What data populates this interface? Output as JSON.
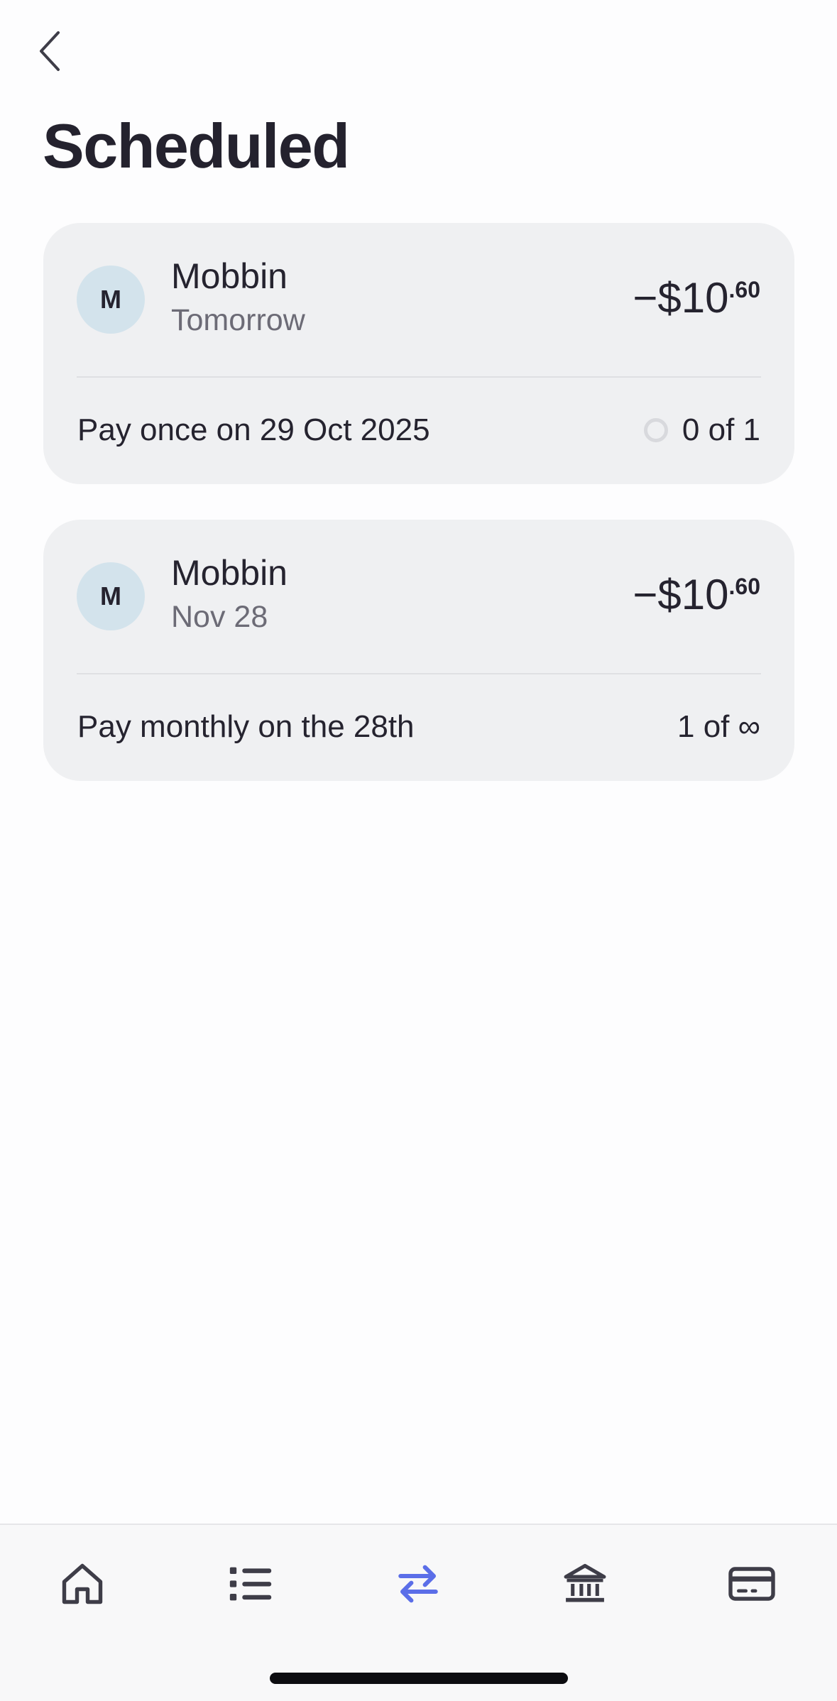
{
  "header": {
    "back_icon": "chevron-left-icon",
    "title": "Scheduled"
  },
  "payments": [
    {
      "avatar_initial": "M",
      "payee": "Mobbin",
      "date": "Tomorrow",
      "amount_main": "−$10",
      "amount_cents": ".60",
      "schedule": "Pay once on 29 Oct 2025",
      "progress": "0 of 1",
      "progress_icon": "empty-circle-icon"
    },
    {
      "avatar_initial": "M",
      "payee": "Mobbin",
      "date": "Nov 28",
      "amount_main": "−$10",
      "amount_cents": ".60",
      "schedule": "Pay monthly on the 28th",
      "progress": "1 of ∞"
    }
  ],
  "tab_bar": {
    "tabs": [
      {
        "icon": "home-icon",
        "active": false
      },
      {
        "icon": "list-icon",
        "active": false
      },
      {
        "icon": "transfer-arrows-icon",
        "active": true
      },
      {
        "icon": "bank-icon",
        "active": false
      },
      {
        "icon": "card-icon",
        "active": false
      }
    ],
    "active_color": "#5b6ee8",
    "inactive_color": "#3e3d48"
  }
}
